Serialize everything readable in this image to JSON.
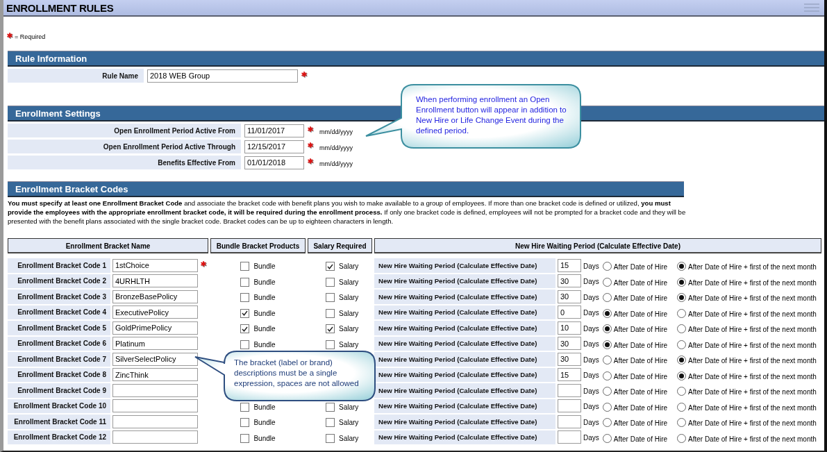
{
  "title": "ENROLLMENT RULES",
  "required_note": "= Required",
  "rule_information": {
    "heading": "Rule Information",
    "fields": [
      {
        "label": "Rule Name",
        "value": "2018 WEB Group",
        "required": true
      }
    ]
  },
  "enrollment_settings": {
    "heading": "Enrollment Settings",
    "fields": [
      {
        "label": "Open Enrollment Period Active From",
        "value": "11/01/2017",
        "required": true,
        "hint": "mm/dd/yyyy"
      },
      {
        "label": "Open Enrollment Period Active Through",
        "value": "12/15/2017",
        "required": true,
        "hint": "mm/dd/yyyy"
      },
      {
        "label": "Benefits Effective From",
        "value": "01/01/2018",
        "required": true,
        "hint": "mm/dd/yyyy"
      }
    ]
  },
  "bracket_codes": {
    "heading": "Enrollment Bracket Codes",
    "description": "**You must specify at least one Enrollment Bracket Code** and associate the bracket code with benefit plans you wish to make available to a group of employees. If more than one bracket code is defined or utilized, **you must provide the employees with the appropriate enrollment bracket code, it will be required during the enrollment process.** If only one bracket code is defined, employees will not be prompted for a bracket code and they will be presented with the benefit plans associated with the single bracket code. Bracket codes can be up to eighteen characters in length.",
    "columns": [
      "Enrollment Bracket Name",
      "Bundle Bracket Products",
      "Salary Required",
      "New Hire Waiting Period (Calculate Effective Date)"
    ],
    "rows": [
      {
        "label": "Enrollment Bracket Code 1",
        "code": "1stChoice",
        "required": true,
        "bundle": {
          "label": "Bundle",
          "checked": false
        },
        "salary": {
          "label": "Salary",
          "checked": true
        },
        "waiting_label": "New Hire Waiting Period (Calculate Effective Date)",
        "days": "15",
        "days_unit": "Days",
        "options": [
          {
            "label": "After Date of Hire",
            "selected": false
          },
          {
            "label": "After Date of Hire + first of the next month",
            "selected": true
          }
        ]
      },
      {
        "label": "Enrollment Bracket Code 2",
        "code": "4URHLTH",
        "required": false,
        "bundle": {
          "label": "Bundle",
          "checked": false
        },
        "salary": {
          "label": "Salary",
          "checked": false
        },
        "waiting_label": "New Hire Waiting Period (Calculate Effective Date)",
        "days": "30",
        "days_unit": "Days",
        "options": [
          {
            "label": "After Date of Hire",
            "selected": false
          },
          {
            "label": "After Date of Hire + first of the next month",
            "selected": true
          }
        ]
      },
      {
        "label": "Enrollment Bracket Code 3",
        "code": "BronzeBasePolicy",
        "required": false,
        "bundle": {
          "label": "Bundle",
          "checked": false
        },
        "salary": {
          "label": "Salary",
          "checked": false
        },
        "waiting_label": "New Hire Waiting Period (Calculate Effective Date)",
        "days": "30",
        "days_unit": "Days",
        "options": [
          {
            "label": "After Date of Hire",
            "selected": false
          },
          {
            "label": "After Date of Hire + first of the next month",
            "selected": true
          }
        ]
      },
      {
        "label": "Enrollment Bracket Code 4",
        "code": "ExecutivePolicy",
        "required": false,
        "bundle": {
          "label": "Bundle",
          "checked": true
        },
        "salary": {
          "label": "Salary",
          "checked": false
        },
        "waiting_label": "New Hire Waiting Period (Calculate Effective Date)",
        "days": "0",
        "days_unit": "Days",
        "options": [
          {
            "label": "After Date of Hire",
            "selected": true
          },
          {
            "label": "After Date of Hire + first of the next month",
            "selected": false
          }
        ]
      },
      {
        "label": "Enrollment Bracket Code 5",
        "code": "GoldPrimePolicy",
        "required": false,
        "bundle": {
          "label": "Bundle",
          "checked": true
        },
        "salary": {
          "label": "Salary",
          "checked": true
        },
        "waiting_label": "New Hire Waiting Period (Calculate Effective Date)",
        "days": "10",
        "days_unit": "Days",
        "options": [
          {
            "label": "After Date of Hire",
            "selected": true
          },
          {
            "label": "After Date of Hire + first of the next month",
            "selected": false
          }
        ]
      },
      {
        "label": "Enrollment Bracket Code 6",
        "code": "Platinum",
        "required": false,
        "bundle": {
          "label": "Bundle",
          "checked": false
        },
        "salary": {
          "label": "Salary",
          "checked": false
        },
        "waiting_label": "New Hire Waiting Period (Calculate Effective Date)",
        "days": "30",
        "days_unit": "Days",
        "options": [
          {
            "label": "After Date of Hire",
            "selected": true
          },
          {
            "label": "After Date of Hire + first of the next month",
            "selected": false
          }
        ]
      },
      {
        "label": "Enrollment Bracket Code 7",
        "code": "SilverSelectPolicy",
        "required": false,
        "waiting_label": "New Hire Waiting Period (Calculate Effective Date)",
        "days": "30",
        "days_unit": "Days",
        "options": [
          {
            "label": "After Date of Hire",
            "selected": false
          },
          {
            "label": "After Date of Hire + first of the next month",
            "selected": true
          }
        ]
      },
      {
        "label": "Enrollment Bracket Code 8",
        "code": "ZincThink",
        "required": false,
        "waiting_label": "New Hire Waiting Period (Calculate Effective Date)",
        "days": "15",
        "days_unit": "Days",
        "options": [
          {
            "label": "After Date of Hire",
            "selected": false
          },
          {
            "label": "After Date of Hire + first of the next month",
            "selected": true
          }
        ]
      },
      {
        "label": "Enrollment Bracket Code 9",
        "code": "",
        "required": false,
        "waiting_label": "New Hire Waiting Period (Calculate Effective Date)",
        "days": "",
        "days_unit": "Days",
        "options": [
          {
            "label": "After Date of Hire",
            "selected": false
          },
          {
            "label": "After Date of Hire + first of the next month",
            "selected": false
          }
        ]
      },
      {
        "label": "Enrollment Bracket Code 10",
        "code": "",
        "required": false,
        "bundle": {
          "label": "Bundle",
          "checked": false
        },
        "salary": {
          "label": "Salary",
          "checked": false
        },
        "waiting_label": "New Hire Waiting Period (Calculate Effective Date)",
        "days": "",
        "days_unit": "Days",
        "options": [
          {
            "label": "After Date of Hire",
            "selected": false
          },
          {
            "label": "After Date of Hire + first of the next month",
            "selected": false
          }
        ]
      },
      {
        "label": "Enrollment Bracket Code 11",
        "code": "",
        "required": false,
        "bundle": {
          "label": "Bundle",
          "checked": false
        },
        "salary": {
          "label": "Salary",
          "checked": false
        },
        "waiting_label": "New Hire Waiting Period (Calculate Effective Date)",
        "days": "",
        "days_unit": "Days",
        "options": [
          {
            "label": "After Date of Hire",
            "selected": false
          },
          {
            "label": "After Date of Hire + first of the next month",
            "selected": false
          }
        ]
      },
      {
        "label": "Enrollment Bracket Code 12",
        "code": "",
        "required": false,
        "bundle": {
          "label": "Bundle",
          "checked": false
        },
        "salary": {
          "label": "Salary",
          "checked": false
        },
        "waiting_label": "New Hire Waiting Period (Calculate Effective Date)",
        "days": "",
        "days_unit": "Days",
        "options": [
          {
            "label": "After Date of Hire",
            "selected": false
          },
          {
            "label": "After Date of Hire + first of the next month",
            "selected": false
          }
        ]
      }
    ]
  },
  "callouts": [
    {
      "text": "When performing enrollment an Open Enrollment button will appear in addition to New Hire or Life Change Event during the defined period."
    },
    {
      "text": "The bracket (label or brand) descriptions must be a single expression, spaces are not allowed"
    }
  ]
}
